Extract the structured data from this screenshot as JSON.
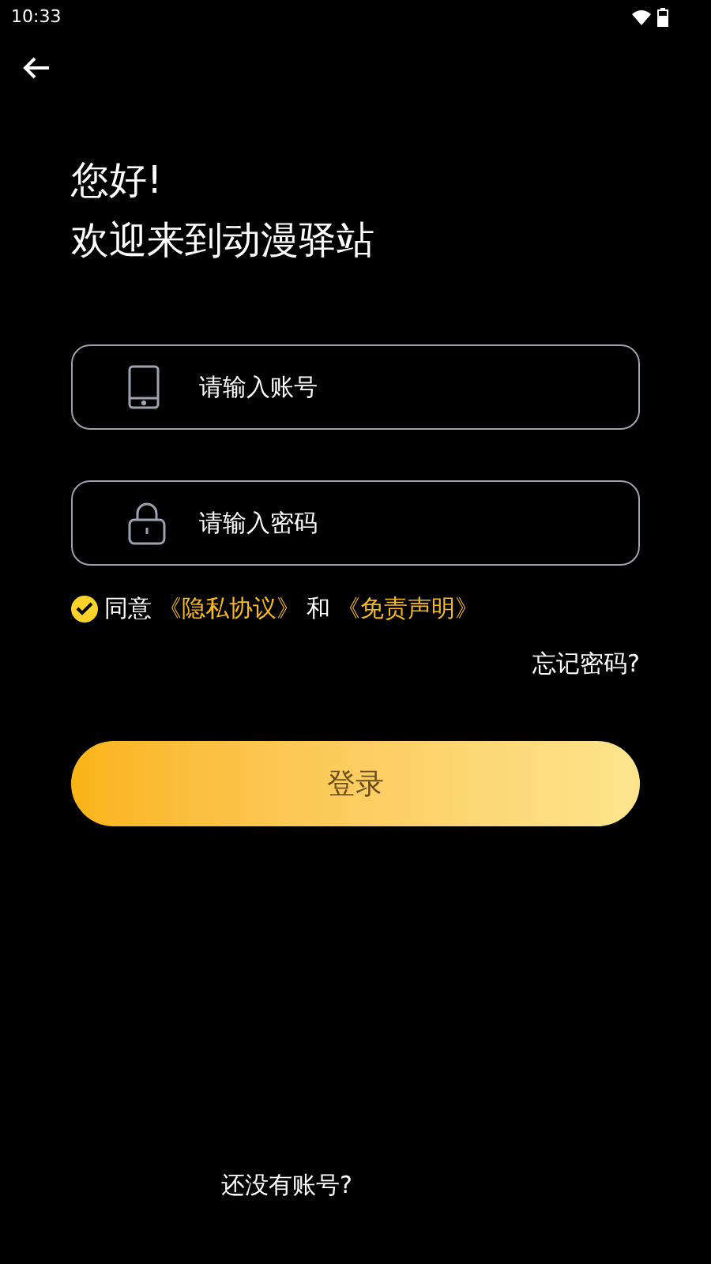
{
  "status_bar": {
    "time": "10:33"
  },
  "greeting": [
    "您好!",
    "欢迎来到动漫驿站"
  ],
  "fields": [
    {
      "kind": "phone",
      "placeholder": "请输入账号"
    },
    {
      "kind": "lock",
      "placeholder": "请输入密码"
    }
  ],
  "agreement": {
    "checked": true,
    "parts": [
      {
        "kind": "text",
        "text": "同意"
      },
      {
        "kind": "link",
        "text": "《隐私协议》"
      },
      {
        "kind": "text",
        "text": "和"
      },
      {
        "kind": "link",
        "text": "《免责声明》"
      }
    ]
  },
  "forgot_password": "忘记密码?",
  "login_button": "登录",
  "register_prompt": "还没有账号?"
}
